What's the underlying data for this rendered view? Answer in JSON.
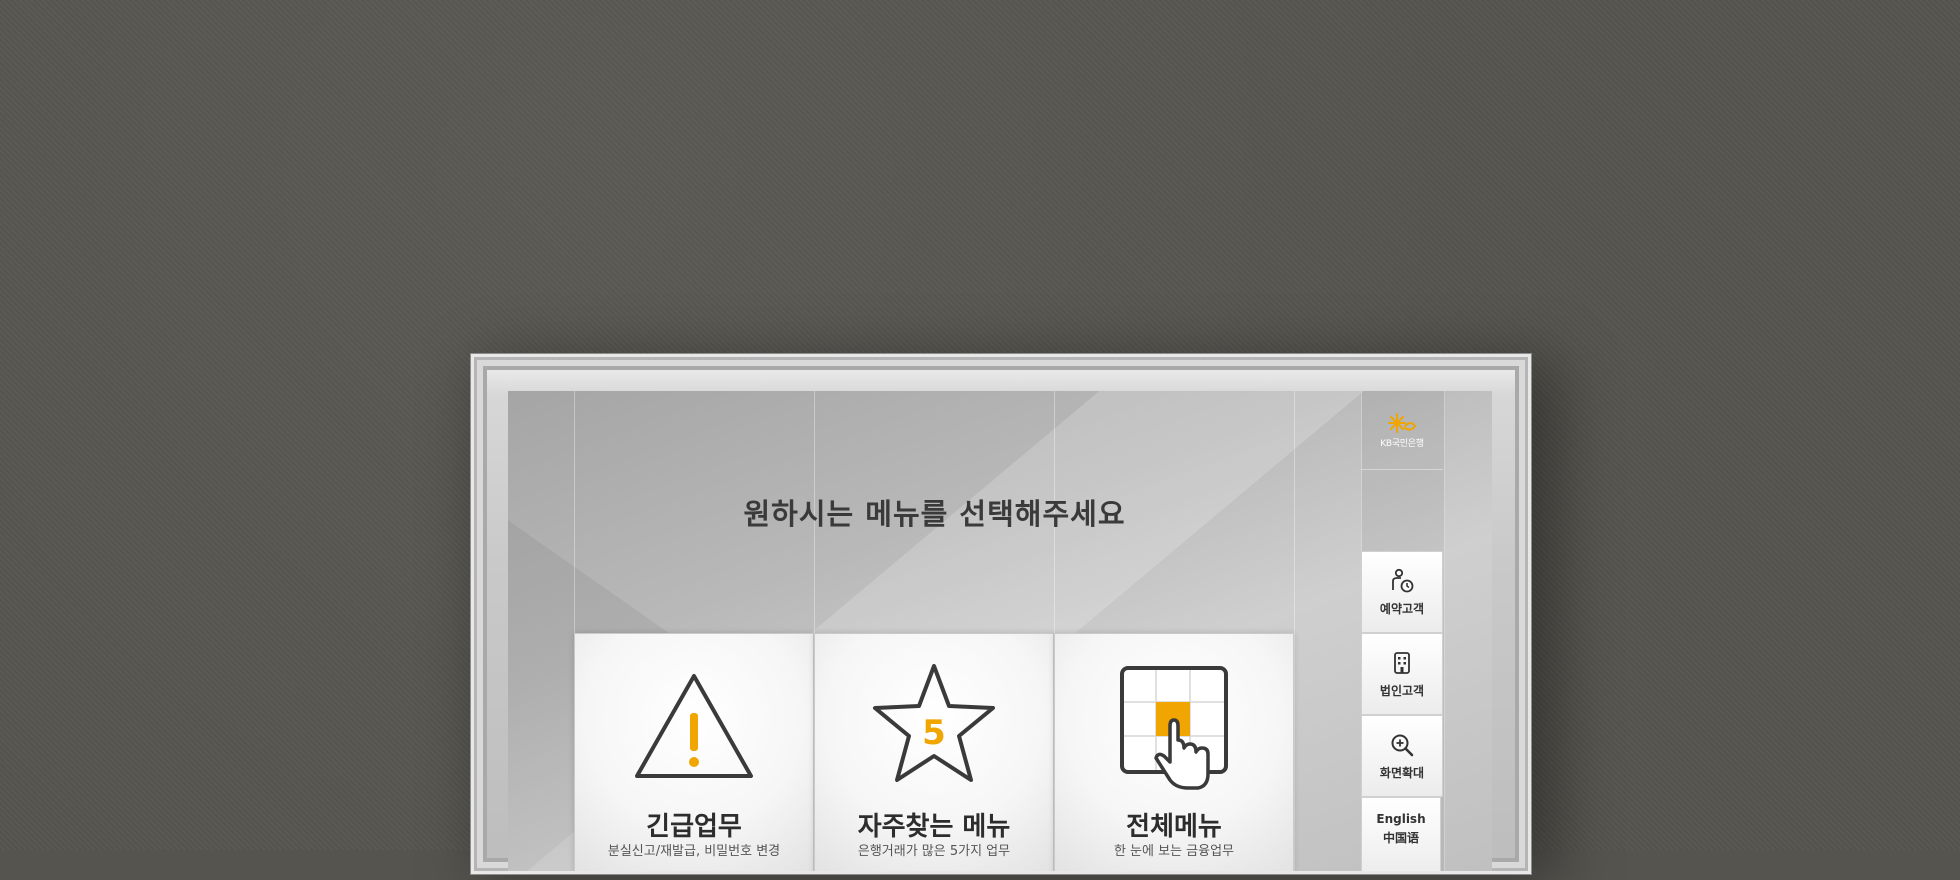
{
  "header": {
    "logo_text": "KB국민은행",
    "title": "원하시는 메뉴를 선택해주세요"
  },
  "cards": [
    {
      "title": "긴급업무",
      "subtitle": "분실신고/재발급, 비밀번호 변경",
      "icon": "warning-icon"
    },
    {
      "title": "자주찾는 메뉴",
      "subtitle": "은행거래가 많은 5가지 업무",
      "icon": "star-five-icon",
      "badge": "5"
    },
    {
      "title": "전체메뉴",
      "subtitle": "한 눈에 보는 금융업무",
      "icon": "grid-pointer-icon"
    }
  ],
  "side_menu": [
    {
      "label": "예약고객",
      "icon": "person-clock-icon"
    },
    {
      "label": "법인고객",
      "icon": "building-icon"
    },
    {
      "label": "화면확대",
      "icon": "zoom-in-icon"
    }
  ],
  "languages": [
    "English",
    "中国语"
  ],
  "colors": {
    "accent": "#f0a500",
    "background_wall": "#56544f",
    "text_dark": "#333333"
  }
}
